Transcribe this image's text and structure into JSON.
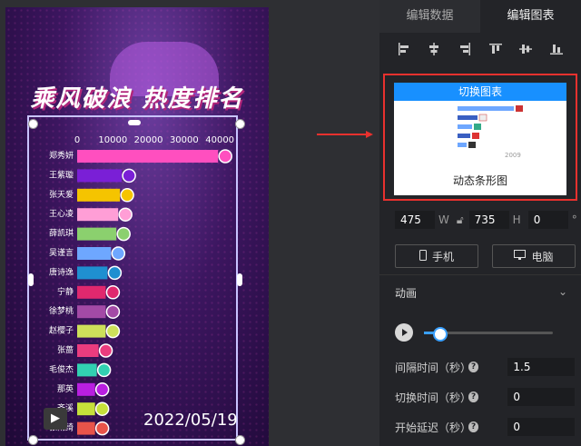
{
  "poster": {
    "title": "乘风破浪 热度排名",
    "date": "2022/05/19",
    "axis_ticks": [
      "0",
      "10000",
      "20000",
      "30000",
      "40000"
    ],
    "bar_colors": [
      "#ff4fbf",
      "#7a1fd6",
      "#f5c400",
      "#ff9ed6",
      "#8bd06e",
      "#6ea7ff",
      "#1f8fd0",
      "#e0286e",
      "#a34aa6",
      "#cde05a",
      "#ea3c7e",
      "#32d0b1",
      "#b91fe0",
      "#c6e03a",
      "#e8544a"
    ]
  },
  "chart_data": {
    "type": "bar",
    "orientation": "horizontal",
    "categories": [
      "郑秀妍",
      "王紫璇",
      "张天爱",
      "王心凌",
      "薛凯琪",
      "吴谨言",
      "唐诗逸",
      "宁静",
      "徐梦桃",
      "赵樱子",
      "张蔷",
      "毛俊杰",
      "那英",
      "齐溪",
      "张雨绮"
    ],
    "values": [
      39500,
      12500,
      12000,
      11500,
      11000,
      9500,
      8500,
      8000,
      8000,
      8000,
      6000,
      5500,
      5000,
      5000,
      5000
    ],
    "xlim": [
      0,
      42000
    ],
    "xticks": [
      0,
      10000,
      20000,
      30000,
      40000
    ],
    "title": "",
    "xlabel": "",
    "ylabel": ""
  },
  "panel": {
    "tabs": [
      "编辑数据",
      "编辑图表"
    ],
    "card_header": "切换图表",
    "card_name": "动态条形图",
    "card_preview_year": "2009",
    "width_value": "475",
    "width_unit": "W",
    "height_value": "735",
    "height_unit": "H",
    "rotation_value": "0",
    "rotation_unit": "°",
    "mobile_label": "手机",
    "desktop_label": "电脑",
    "animation_label": "动画",
    "animation_progress": 0.12,
    "interval_label": "间隔时间（秒）",
    "interval_value": "1.5",
    "switch_label": "切换时间（秒）",
    "switch_value": "0",
    "delay_label": "开始延迟（秒）",
    "delay_value": "0"
  },
  "colors": {
    "accent": "#1890ff",
    "highlight_border": "#e8312e"
  }
}
